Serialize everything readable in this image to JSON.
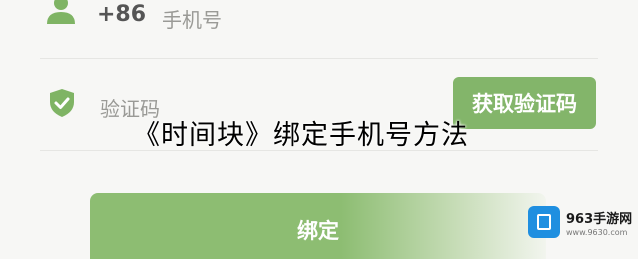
{
  "phone_field": {
    "country_code": "+86",
    "placeholder": "手机号"
  },
  "code_field": {
    "placeholder": "验证码",
    "get_code_label": "获取验证码"
  },
  "overlay_title": "《时间块》绑定手机号方法",
  "bind_button_label": "绑定",
  "watermark": {
    "title": "963手游网",
    "url": "www.9630.com"
  },
  "colors": {
    "accent_green": "#83b56a",
    "icon_green": "#7fb464",
    "watermark_blue": "#1f8fe0"
  },
  "icons": [
    "user-icon",
    "shield-check-icon",
    "watermark-logo-icon"
  ]
}
